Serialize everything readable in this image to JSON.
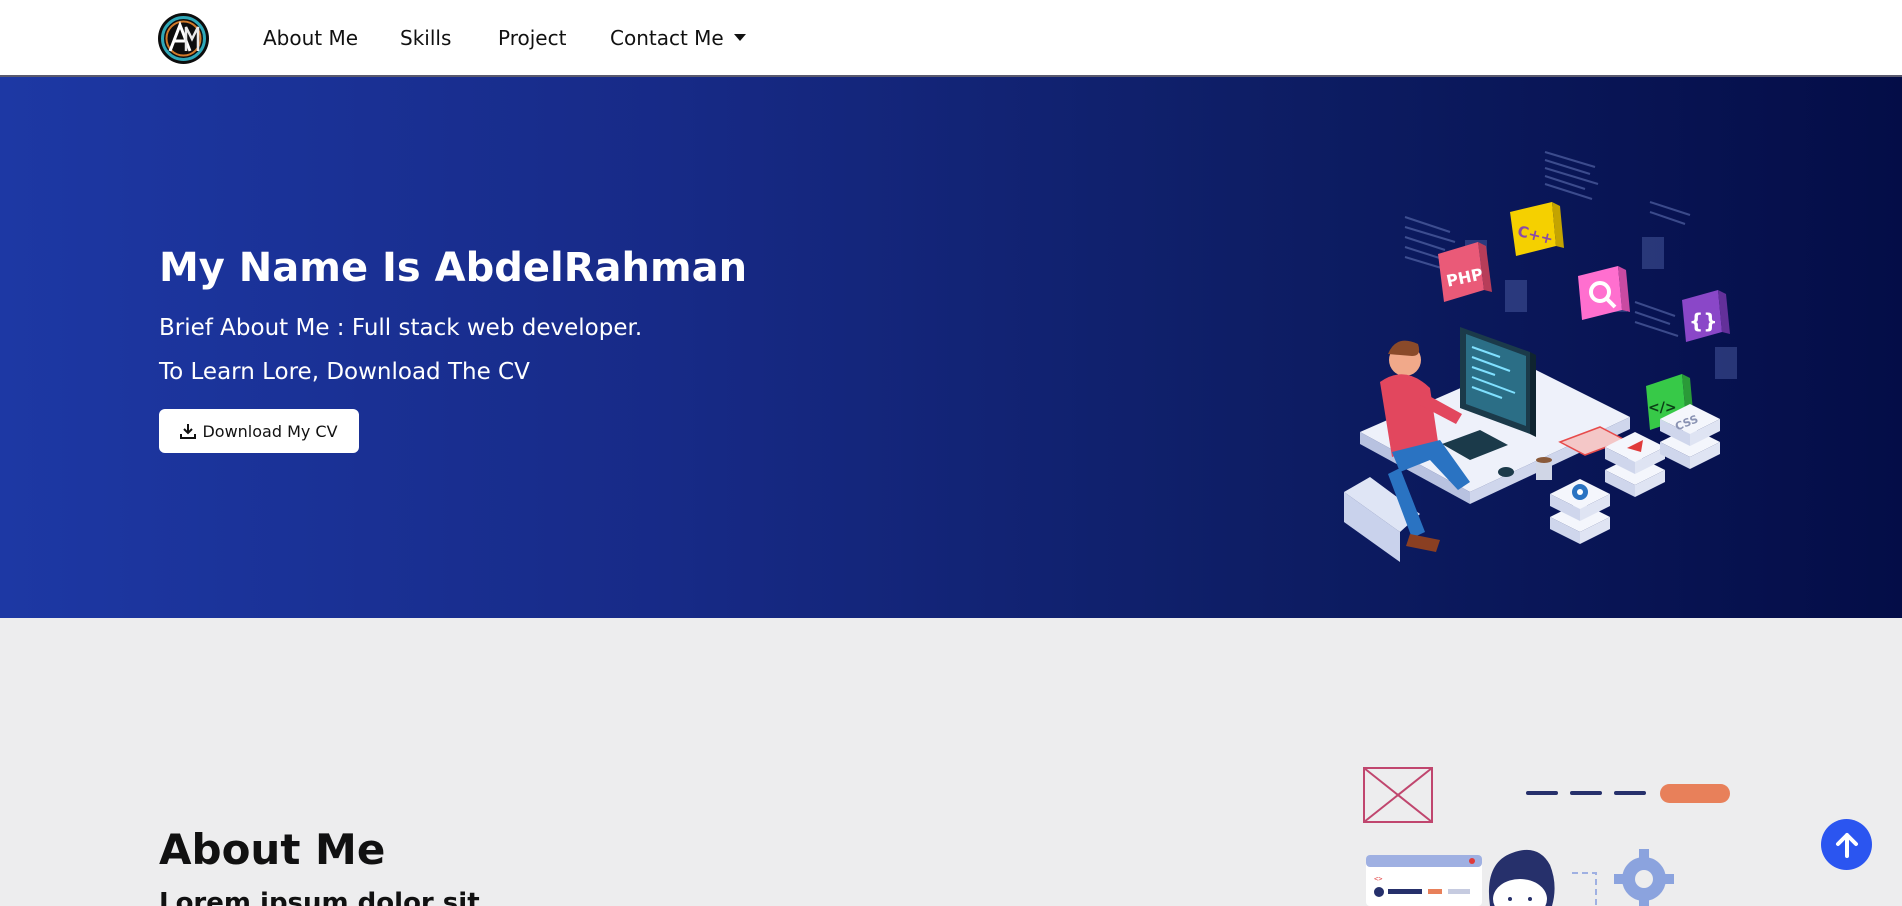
{
  "nav": {
    "links": [
      "About Me",
      "Skills",
      "Project",
      "Contact Me"
    ]
  },
  "hero": {
    "title": "My Name Is AbdelRahman",
    "brief": "Brief About Me : Full stack web developer.",
    "learn": "To Learn Lore, Download The CV",
    "download_label": "Download My CV",
    "badges": [
      "PHP",
      "C++",
      "{}",
      "</>",
      "CSS"
    ]
  },
  "about": {
    "title": "About Me",
    "subtitle": "Lorem ipsum dolor sit"
  },
  "colors": {
    "hero_gradient_start": "#1d38a4",
    "hero_gradient_end": "#040d47",
    "scroll_top_button": "#2b55f0",
    "page_background": "#ededee"
  },
  "icons": [
    "logo-icon",
    "download-icon",
    "arrow-up-icon",
    "caret-down-icon"
  ]
}
